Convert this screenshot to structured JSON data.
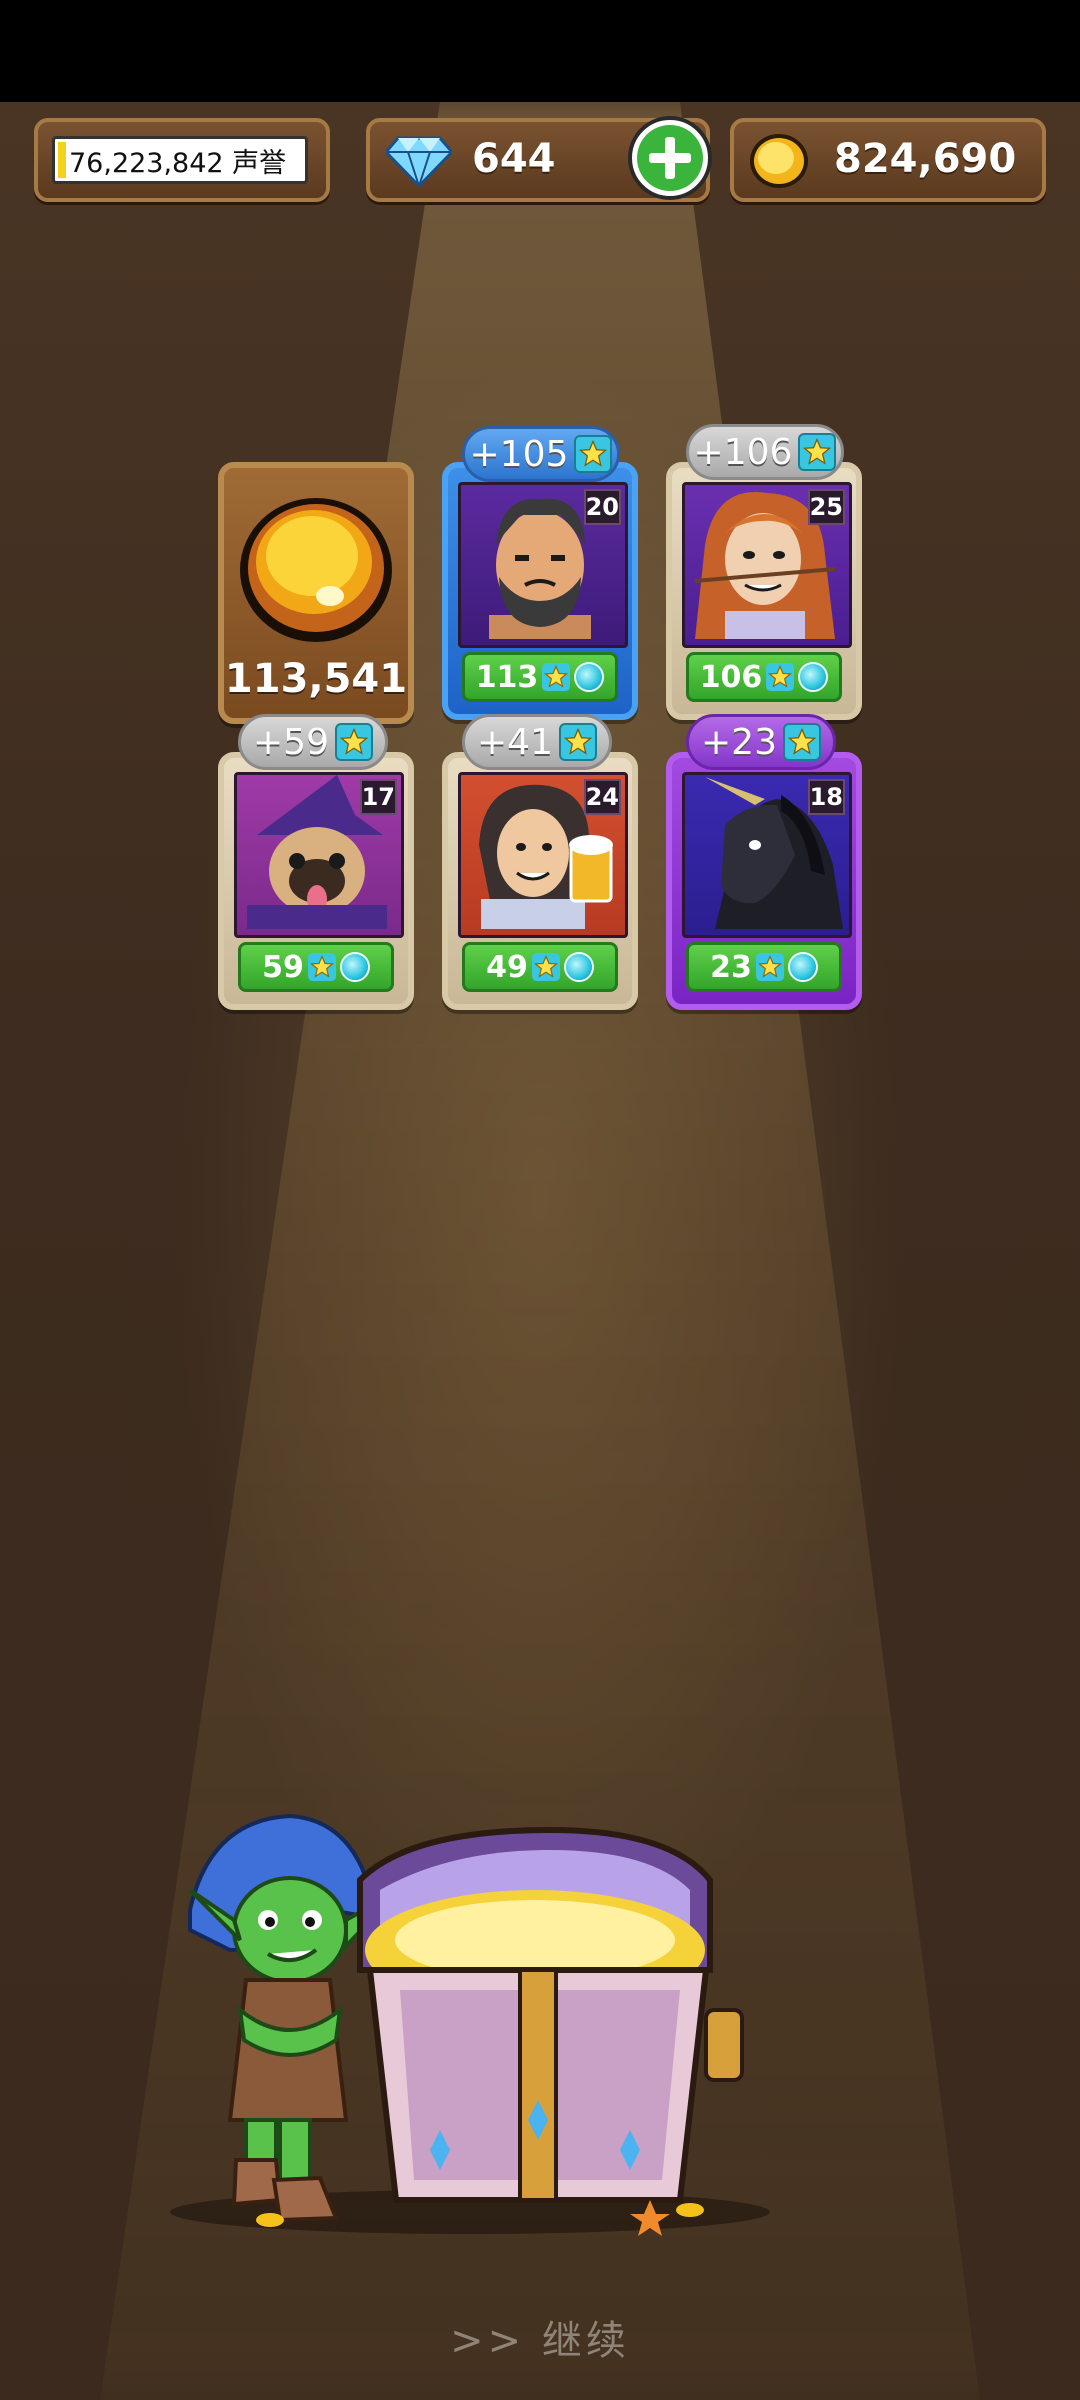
{
  "header": {
    "fame_value": "76,223,842 声誉",
    "gems": "644",
    "gold": "824,690"
  },
  "reward": {
    "gold_amount": "113,541"
  },
  "heroes": [
    {
      "bonus": "+105",
      "level": "20",
      "value": "113",
      "tier": "blue"
    },
    {
      "bonus": "+106",
      "level": "25",
      "value": "106",
      "tier": "common"
    },
    {
      "bonus": "+59",
      "level": "17",
      "value": "59",
      "tier": "common"
    },
    {
      "bonus": "+41",
      "level": "24",
      "value": "49",
      "tier": "common"
    },
    {
      "bonus": "+23",
      "level": "18",
      "value": "23",
      "tier": "purple"
    }
  ],
  "footer": {
    "continue_label": ">> 继续"
  },
  "colors": {
    "background": "#3a2a1e",
    "pill_brown": "#6b4527",
    "stat_green": "#3fb32f",
    "blue_tier": "#2d74cf",
    "purple_tier": "#8336c9"
  }
}
